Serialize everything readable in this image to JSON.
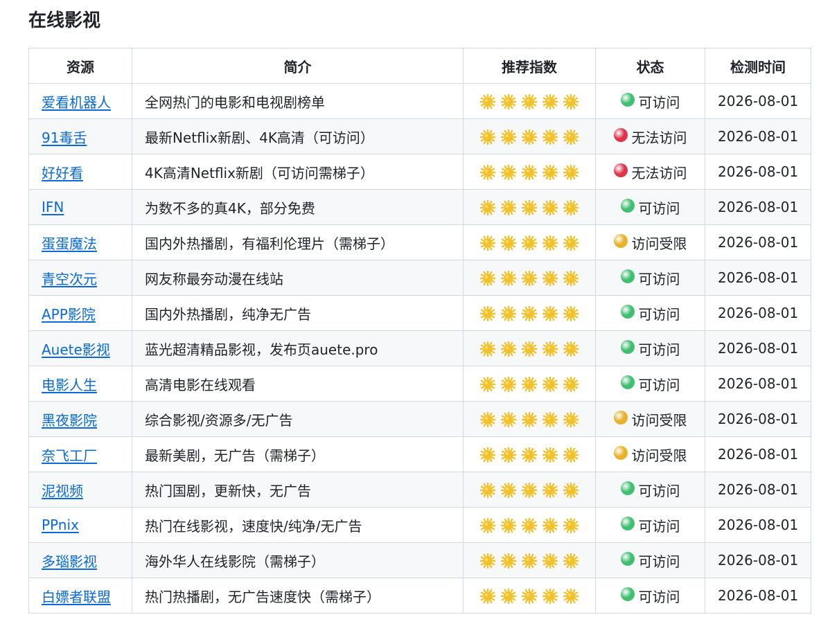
{
  "title": "在线影视",
  "table": {
    "headers": [
      "资源",
      "简介",
      "推荐指数",
      "状态",
      "检测时间"
    ],
    "rows": [
      {
        "name": "爱看机器人",
        "desc": "全网热门的电影和电视剧榜单",
        "rating": 5,
        "status": "可访问",
        "status_type": "ok",
        "date": "2026-08-01"
      },
      {
        "name": "91毒舌",
        "desc": "最新Netflix新剧、4K高清（可访问）",
        "rating": 5,
        "status": "无法访问",
        "status_type": "down",
        "date": "2026-08-01"
      },
      {
        "name": "好好看",
        "desc": "4K高清Netflix新剧（可访问需梯子）",
        "rating": 5,
        "status": "无法访问",
        "status_type": "down",
        "date": "2026-08-01"
      },
      {
        "name": "IFN",
        "desc": "为数不多的真4K，部分免费",
        "rating": 5,
        "status": "可访问",
        "status_type": "ok",
        "date": "2026-08-01"
      },
      {
        "name": "蛋蛋魔法",
        "desc": "国内外热播剧，有福利伦理片（需梯子）",
        "rating": 5,
        "status": "访问受限",
        "status_type": "limited",
        "date": "2026-08-01"
      },
      {
        "name": "青空次元",
        "desc": "网友称最夯动漫在线站",
        "rating": 5,
        "status": "可访问",
        "status_type": "ok",
        "date": "2026-08-01"
      },
      {
        "name": "APP影院",
        "desc": "国内外热播剧，纯净无广告",
        "rating": 5,
        "status": "可访问",
        "status_type": "ok",
        "date": "2026-08-01"
      },
      {
        "name": "Auete影视",
        "desc": "蓝光超清精品影视，发布页auete.pro",
        "rating": 5,
        "status": "可访问",
        "status_type": "ok",
        "date": "2026-08-01"
      },
      {
        "name": "电影人生",
        "desc": "高清电影在线观看",
        "rating": 5,
        "status": "可访问",
        "status_type": "ok",
        "date": "2026-08-01"
      },
      {
        "name": "黑夜影院",
        "desc": "综合影视/资源多/无广告",
        "rating": 5,
        "status": "访问受限",
        "status_type": "limited",
        "date": "2026-08-01"
      },
      {
        "name": "奈飞工厂",
        "desc": "最新美剧，无广告（需梯子）",
        "rating": 5,
        "status": "访问受限",
        "status_type": "limited",
        "date": "2026-08-01"
      },
      {
        "name": "泥视频",
        "desc": "热门国剧，更新快，无广告",
        "rating": 5,
        "status": "可访问",
        "status_type": "ok",
        "date": "2026-08-01"
      },
      {
        "name": "PPnix",
        "desc": "热门在线影视，速度快/纯净/无广告",
        "rating": 5,
        "status": "可访问",
        "status_type": "ok",
        "date": "2026-08-01"
      },
      {
        "name": "多瑙影视",
        "desc": "海外华人在线影院（需梯子）",
        "rating": 5,
        "status": "可访问",
        "status_type": "ok",
        "date": "2026-08-01"
      },
      {
        "name": "白嫖者联盟",
        "desc": "热门热播剧，无广告速度快（需梯子）",
        "rating": 5,
        "status": "可访问",
        "status_type": "ok",
        "date": "2026-08-01"
      }
    ]
  },
  "icons": {
    "rating": "sun-star-icon",
    "status_ok": "green-circle-icon",
    "status_down": "red-circle-icon",
    "status_limited": "yellow-circle-icon"
  },
  "colors": {
    "link": "#0969da",
    "star": "#f2c12e",
    "ok": "#3fbf6f",
    "down": "#e0344a",
    "limited": "#e8b22a"
  }
}
